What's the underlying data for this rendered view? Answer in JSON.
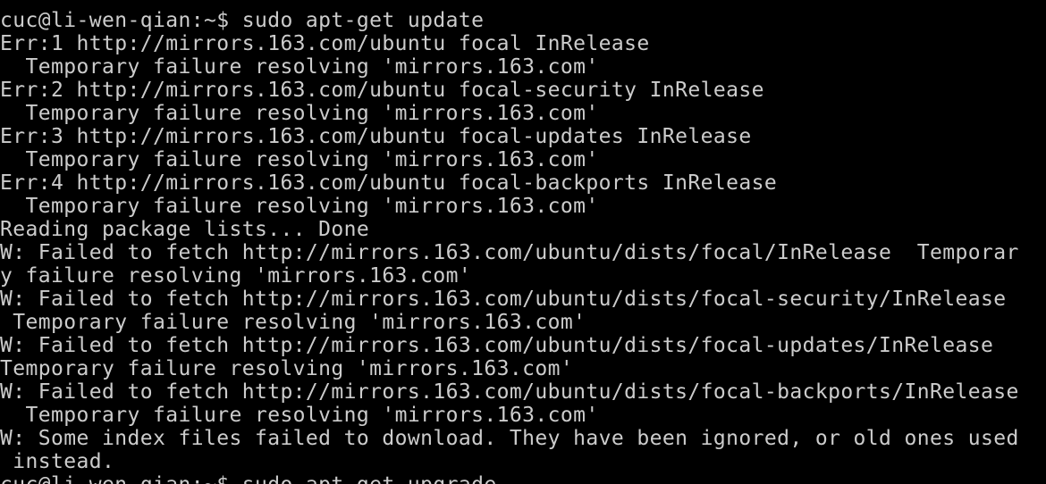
{
  "terminal": {
    "lines": [
      "cuc@li-wen-qian:~$ sudo apt-get update",
      "Err:1 http://mirrors.163.com/ubuntu focal InRelease",
      "  Temporary failure resolving 'mirrors.163.com'",
      "Err:2 http://mirrors.163.com/ubuntu focal-security InRelease",
      "  Temporary failure resolving 'mirrors.163.com'",
      "Err:3 http://mirrors.163.com/ubuntu focal-updates InRelease",
      "  Temporary failure resolving 'mirrors.163.com'",
      "Err:4 http://mirrors.163.com/ubuntu focal-backports InRelease",
      "  Temporary failure resolving 'mirrors.163.com'",
      "Reading package lists... Done",
      "W: Failed to fetch http://mirrors.163.com/ubuntu/dists/focal/InRelease  Temporar",
      "y failure resolving 'mirrors.163.com'",
      "W: Failed to fetch http://mirrors.163.com/ubuntu/dists/focal-security/InRelease",
      " Temporary failure resolving 'mirrors.163.com'",
      "W: Failed to fetch http://mirrors.163.com/ubuntu/dists/focal-updates/InRelease",
      "Temporary failure resolving 'mirrors.163.com'",
      "W: Failed to fetch http://mirrors.163.com/ubuntu/dists/focal-backports/InRelease",
      "  Temporary failure resolving 'mirrors.163.com'",
      "W: Some index files failed to download. They have been ignored, or old ones used",
      " instead.",
      "cuc@li-wen-qian:~$ sudo apt-get upgrade"
    ]
  },
  "colors": {
    "background": "#000000",
    "text": "#cccccc"
  }
}
